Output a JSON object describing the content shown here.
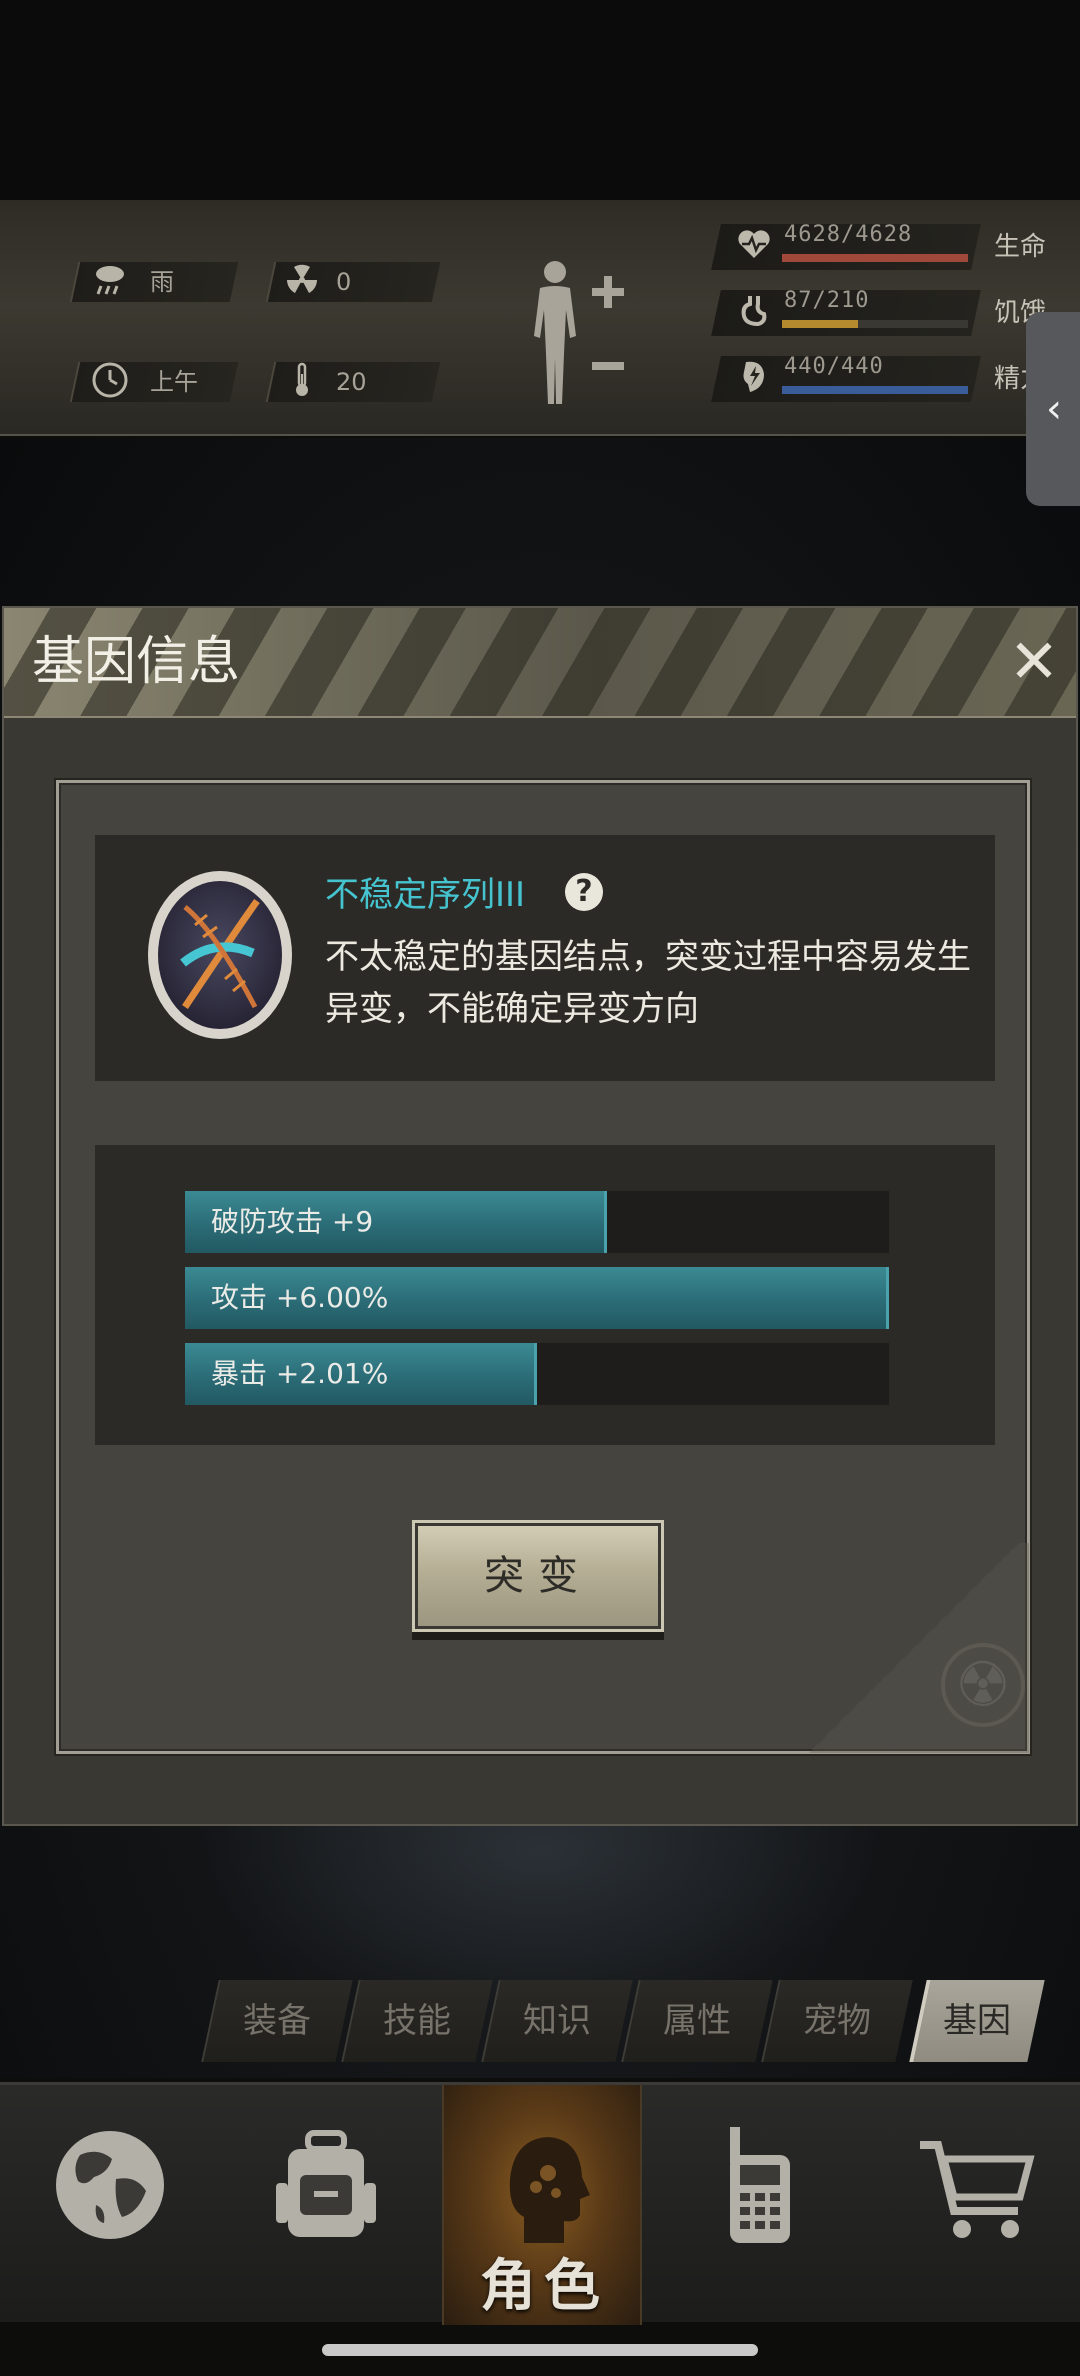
{
  "status": {
    "weather": {
      "icon": "rain-icon",
      "label": "雨"
    },
    "radiation": {
      "icon": "radiation-icon",
      "value": "0"
    },
    "time": {
      "icon": "clock-icon",
      "label": "上午"
    },
    "temperature": {
      "icon": "thermometer-icon",
      "value": "20"
    },
    "vitals": [
      {
        "icon": "heart-icon",
        "value": "4628/4628",
        "label": "生命",
        "fraction": 1.0,
        "color": "#a0493a"
      },
      {
        "icon": "stomach-icon",
        "value": "87/210",
        "label": "饥饿",
        "fraction": 0.41,
        "color": "#b58a2e"
      },
      {
        "icon": "energy-icon",
        "value": "440/440",
        "label": "精力",
        "fraction": 1.0,
        "color": "#3a5d9a"
      }
    ]
  },
  "modal": {
    "title": "基因信息",
    "close": "✕",
    "gene": {
      "name": "不稳定序列III",
      "help": "?",
      "description": "不太稳定的基因结点，突变过程中容易发生异变，不能确定异变方向"
    },
    "stats": [
      {
        "label": "破防攻击 +9",
        "fraction": 0.6
      },
      {
        "label": "攻击 +6.00%",
        "fraction": 1.0
      },
      {
        "label": "暴击 +2.01%",
        "fraction": 0.5
      }
    ],
    "mutate_button": "突变"
  },
  "subtabs": [
    {
      "label": "装备",
      "active": false
    },
    {
      "label": "技能",
      "active": false
    },
    {
      "label": "知识",
      "active": false
    },
    {
      "label": "属性",
      "active": false
    },
    {
      "label": "宠物",
      "active": false
    },
    {
      "label": "基因",
      "active": true
    }
  ],
  "bottom_nav": [
    {
      "icon": "globe-icon",
      "label": ""
    },
    {
      "icon": "backpack-icon",
      "label": ""
    },
    {
      "icon": "character-icon",
      "label": "角色",
      "active": true
    },
    {
      "icon": "radio-icon",
      "label": ""
    },
    {
      "icon": "cart-icon",
      "label": ""
    }
  ],
  "colors": {
    "accent": "#45c4cf",
    "bar": "#2b6c77"
  }
}
